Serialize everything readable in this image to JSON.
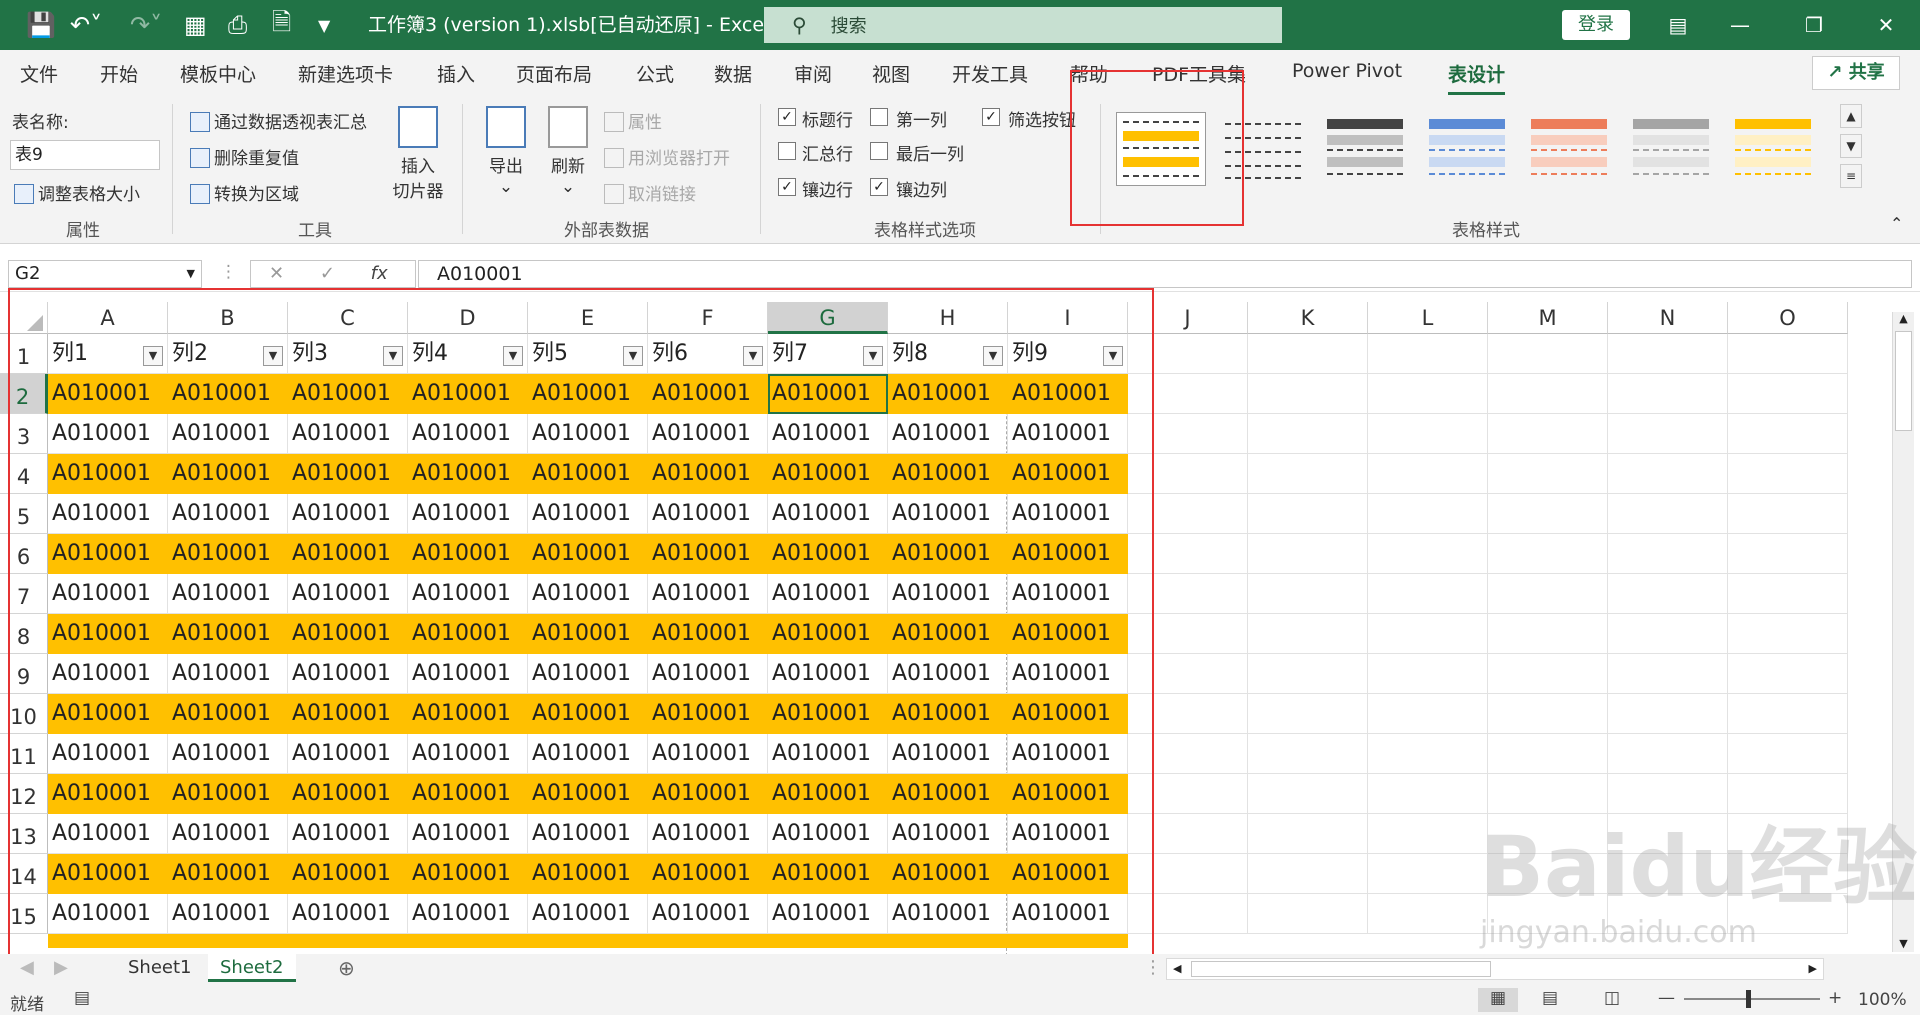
{
  "window": {
    "title": "工作簿3 (version 1).xlsb[已自动还原] - Excel",
    "search_placeholder": "搜索",
    "login_label": "登录",
    "share_label": "共享"
  },
  "quick_access": [
    "save-icon",
    "undo-icon",
    "redo-icon",
    "form-icon",
    "print-preview-icon",
    "export-icon",
    "customize-icon"
  ],
  "tabs": [
    "文件",
    "开始",
    "模板中心",
    "新建选项卡",
    "插入",
    "页面布局",
    "公式",
    "数据",
    "审阅",
    "视图",
    "开发工具",
    "帮助",
    "PDF工具集",
    "Power Pivot",
    "表设计"
  ],
  "active_tab": "表设计",
  "ribbon": {
    "properties": {
      "label": "表名称:",
      "table_name": "表9",
      "resize": "调整表格大小",
      "group": "属性"
    },
    "tools": {
      "pivot": "通过数据透视表汇总",
      "remove_dup": "删除重复值",
      "convert": "转换为区域",
      "slicer_line1": "插入",
      "slicer_line2": "切片器",
      "group": "工具"
    },
    "external": {
      "export": "导出",
      "refresh": "刷新",
      "props": "属性",
      "open_browser": "用浏览器打开",
      "unlink": "取消链接",
      "group": "外部表数据"
    },
    "style_options": {
      "items": [
        {
          "label": "标题行",
          "checked": true
        },
        {
          "label": "第一列",
          "checked": false
        },
        {
          "label": "筛选按钮",
          "checked": true
        },
        {
          "label": "汇总行",
          "checked": false
        },
        {
          "label": "最后一列",
          "checked": false
        },
        {
          "label": "镶边行",
          "checked": true
        },
        {
          "label": "镶边列",
          "checked": true
        }
      ],
      "group": "表格样式选项"
    },
    "styles": {
      "group": "表格样式"
    }
  },
  "formula_bar": {
    "cell_ref": "G2",
    "fx": "fx",
    "value": "A010001"
  },
  "grid": {
    "columns": [
      "A",
      "B",
      "C",
      "D",
      "E",
      "F",
      "G",
      "H",
      "I",
      "J",
      "K",
      "L",
      "M",
      "N",
      "O"
    ],
    "headers": [
      "列1",
      "列2",
      "列3",
      "列4",
      "列5",
      "列6",
      "列7",
      "列8",
      "列9"
    ],
    "rows": [
      "1",
      "2",
      "3",
      "4",
      "5",
      "6",
      "7",
      "8",
      "9",
      "10",
      "11",
      "12",
      "13",
      "14",
      "15"
    ],
    "cell_value": "A010001",
    "selected_col": "G",
    "selected_row": "2",
    "band_color": "#ffc000"
  },
  "sheets": [
    "Sheet1",
    "Sheet2"
  ],
  "active_sheet": "Sheet2",
  "status": {
    "ready": "就绪",
    "zoom": "100%"
  },
  "colors": {
    "accent": "#217346",
    "highlight": "#e53232"
  },
  "watermark": {
    "main": "Baidu经验",
    "sub": "jingyan.baidu.com"
  }
}
